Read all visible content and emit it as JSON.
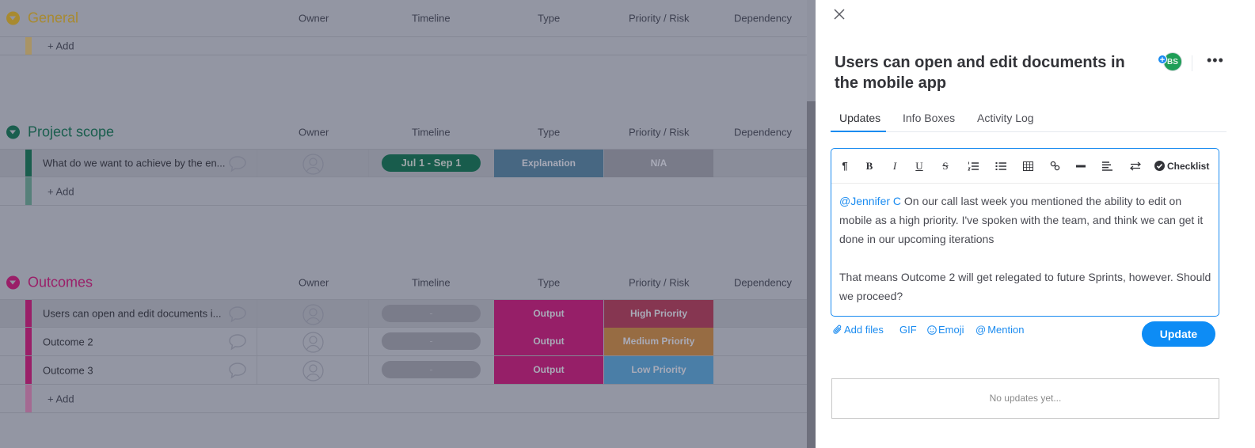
{
  "board": {
    "columns": [
      "Owner",
      "Timeline",
      "Type",
      "Priority / Risk",
      "Dependency"
    ],
    "add_label": "+ Add",
    "groups": [
      {
        "title": "General",
        "color": "#a88a30",
        "rows": []
      },
      {
        "title": "Project scope",
        "color": "#1a5e4e",
        "rows": [
          {
            "name": "What do we want to achieve by the en...",
            "timeline": "Jul 1 - Sep 1",
            "type": "Explanation",
            "priority": "N/A"
          }
        ]
      },
      {
        "title": "Outcomes",
        "color": "#9a1f68",
        "rows": [
          {
            "name": "Users can open and edit documents i...",
            "timeline": "-",
            "type": "Output",
            "priority": "High Priority"
          },
          {
            "name": "Outcome 2",
            "timeline": "-",
            "type": "Output",
            "priority": "Medium Priority"
          },
          {
            "name": "Outcome 3",
            "timeline": "-",
            "type": "Output",
            "priority": "Low Priority"
          }
        ]
      }
    ],
    "colors": {
      "timeline_set": "#185c4c",
      "timeline_empty": "#7a7c8a",
      "type_explanation": "#476782",
      "type_output": "#961f68",
      "priority_na": "#797b89",
      "priority_high": "#863651",
      "priority_medium": "#976c43",
      "priority_low": "#4a7ea7"
    }
  },
  "panel": {
    "title": "Users can open and edit documents in the mobile app",
    "avatar_initials": "BS",
    "tabs": [
      "Updates",
      "Info Boxes",
      "Activity Log"
    ],
    "active_tab": "Updates",
    "toolbar": {
      "checklist_label": "Checklist"
    },
    "editor": {
      "mention": "@Jennifer C",
      "paragraph1": " On our call last week you mentioned the ability to edit on mobile as a high priority. I've spoken with the team, and think we can get it done in our upcoming iterations",
      "paragraph2": "That means Outcome 2 will get relegated to future Sprints, however. Should we proceed?"
    },
    "actions": {
      "add_files": "Add files",
      "gif": "GIF",
      "emoji": "Emoji",
      "mention": "Mention",
      "update": "Update"
    },
    "empty_state": "No updates yet..."
  }
}
